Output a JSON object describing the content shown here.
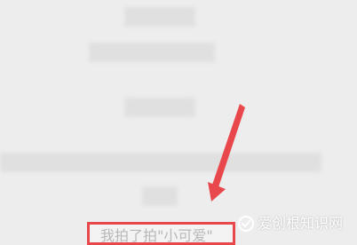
{
  "message": {
    "text": "我拍了拍\"小可爱\""
  },
  "watermark": {
    "text": "爱创根知识网"
  },
  "colors": {
    "highlight": "#e8484b",
    "arrow": "#e8484b",
    "background": "#ededed",
    "blur_block": "#e0e0e0",
    "text_gray": "#b8b8b8"
  }
}
